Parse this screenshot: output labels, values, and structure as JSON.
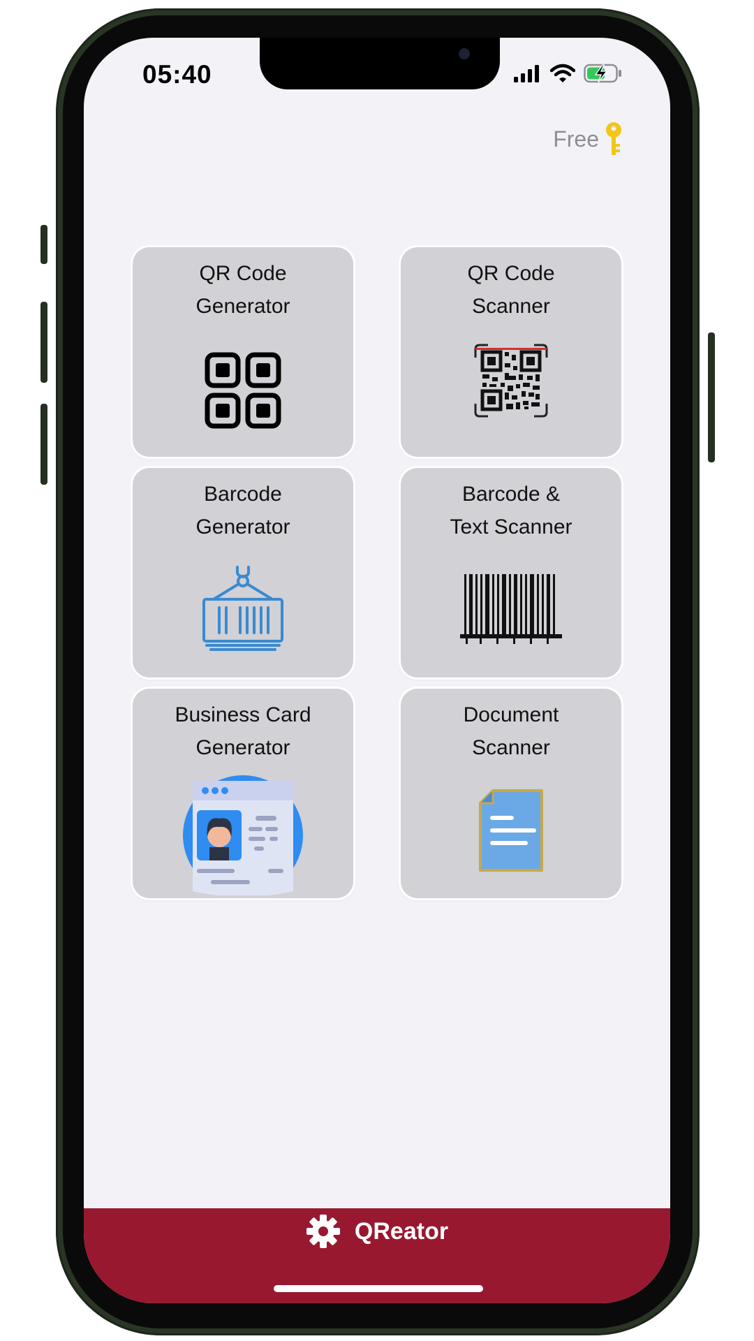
{
  "status_bar": {
    "time": "05:40",
    "icons": [
      "cellular-signal-icon",
      "wifi-icon",
      "battery-charging-icon"
    ]
  },
  "header": {
    "plan_label": "Free",
    "plan_icon": "key-icon",
    "key_color": "#f5c518"
  },
  "tiles": [
    {
      "title": "QR Code\nGenerator",
      "icon": "qr-code-icon"
    },
    {
      "title": "QR Code\nScanner",
      "icon": "qr-scan-icon"
    },
    {
      "title": "Barcode\nGenerator",
      "icon": "shipping-container-icon"
    },
    {
      "title": "Barcode &\nText Scanner",
      "icon": "barcode-icon"
    },
    {
      "title": "Business Card\nGenerator",
      "icon": "id-card-icon"
    },
    {
      "title": "Document\nScanner",
      "icon": "document-icon"
    }
  ],
  "bottom_bar": {
    "app_name": "QReator",
    "settings_icon": "gear-icon",
    "color": "#981830"
  }
}
